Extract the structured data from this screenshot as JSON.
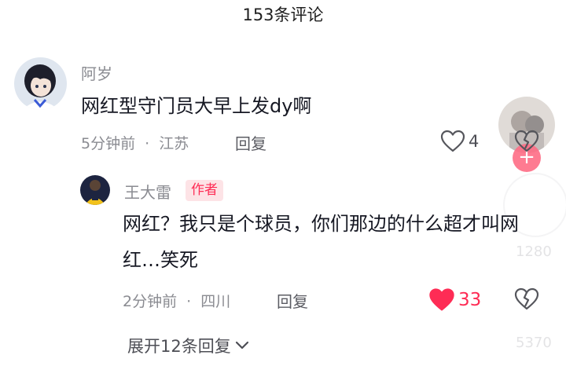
{
  "header": {
    "title": "153条评论"
  },
  "comments": [
    {
      "username": "阿岁",
      "text": "网红型守门员大早上发dy啊",
      "time": "5分钟前",
      "separator": "·",
      "location": "江苏",
      "reply_label": "回复",
      "likes": "4",
      "liked": false,
      "avatar_icon": "anime-boy-avatar-icon"
    },
    {
      "username": "王大雷",
      "badge": "作者",
      "text": "网红？我只是个球员，你们那边的什么超才叫网红…笑死",
      "time": "2分钟前",
      "separator": "·",
      "location": "四川",
      "reply_label": "回复",
      "likes": "33",
      "liked": true,
      "avatar_icon": "goalkeeper-avatar-icon"
    }
  ],
  "expand": {
    "label": "展开12条回复"
  },
  "side_overlay": {
    "follow_symbol": "+",
    "ghost_top": "1280",
    "ghost_bottom": "5370"
  },
  "colors": {
    "accent": "#fe2c55",
    "muted": "#8a8b91",
    "text": "#161823",
    "badge_bg": "#fde3e6"
  }
}
